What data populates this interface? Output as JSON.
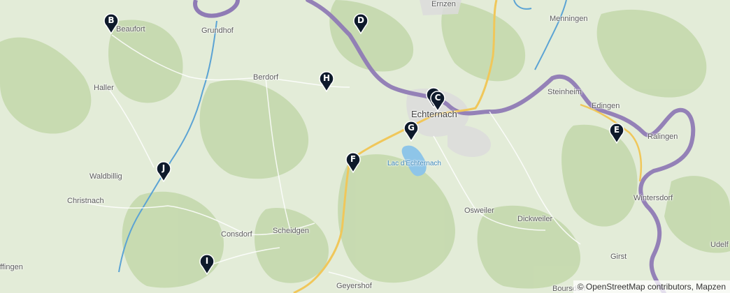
{
  "places": {
    "beaufort": "Beaufort",
    "grundhof": "Grundhof",
    "haller": "Haller",
    "berdorf": "Berdorf",
    "waldbillig": "Waldbillig",
    "christnach": "Christnach",
    "consdorf": "Consdorf",
    "scheidgen": "Scheidgen",
    "geyershof": "Geyershof",
    "echternach": "Echternach",
    "lac_echternach": "Lac d'Echternach",
    "osweiler": "Osweiler",
    "dickweiler": "Dickweiler",
    "ernzen": "Ernzen",
    "menningen": "Menningen",
    "steinheim": "Steinheim",
    "edingen": "Edingen",
    "ralingen": "Ralingen",
    "wintersdorf": "Wintersdorf",
    "girst": "Girst",
    "udelf": "Udelf",
    "boursdorf": "Boursdorf",
    "ffingen": "ffingen"
  },
  "markers": [
    {
      "id": "A",
      "label": ""
    },
    {
      "id": "B",
      "label": "B"
    },
    {
      "id": "C",
      "label": "C"
    },
    {
      "id": "D",
      "label": "D"
    },
    {
      "id": "E",
      "label": "E"
    },
    {
      "id": "F",
      "label": "F"
    },
    {
      "id": "G",
      "label": "G"
    },
    {
      "id": "H",
      "label": "H"
    },
    {
      "id": "I",
      "label": "I"
    },
    {
      "id": "J",
      "label": "J"
    }
  ],
  "attribution": "© OpenStreetMap contributors, Mapzen",
  "colors": {
    "marker": "#0e1a2b",
    "border": "#8f7bb5",
    "river": "#5ba3d4",
    "road_major": "#f0c75a",
    "forest": "#b9d2a2",
    "lake": "#8ec5e8"
  }
}
